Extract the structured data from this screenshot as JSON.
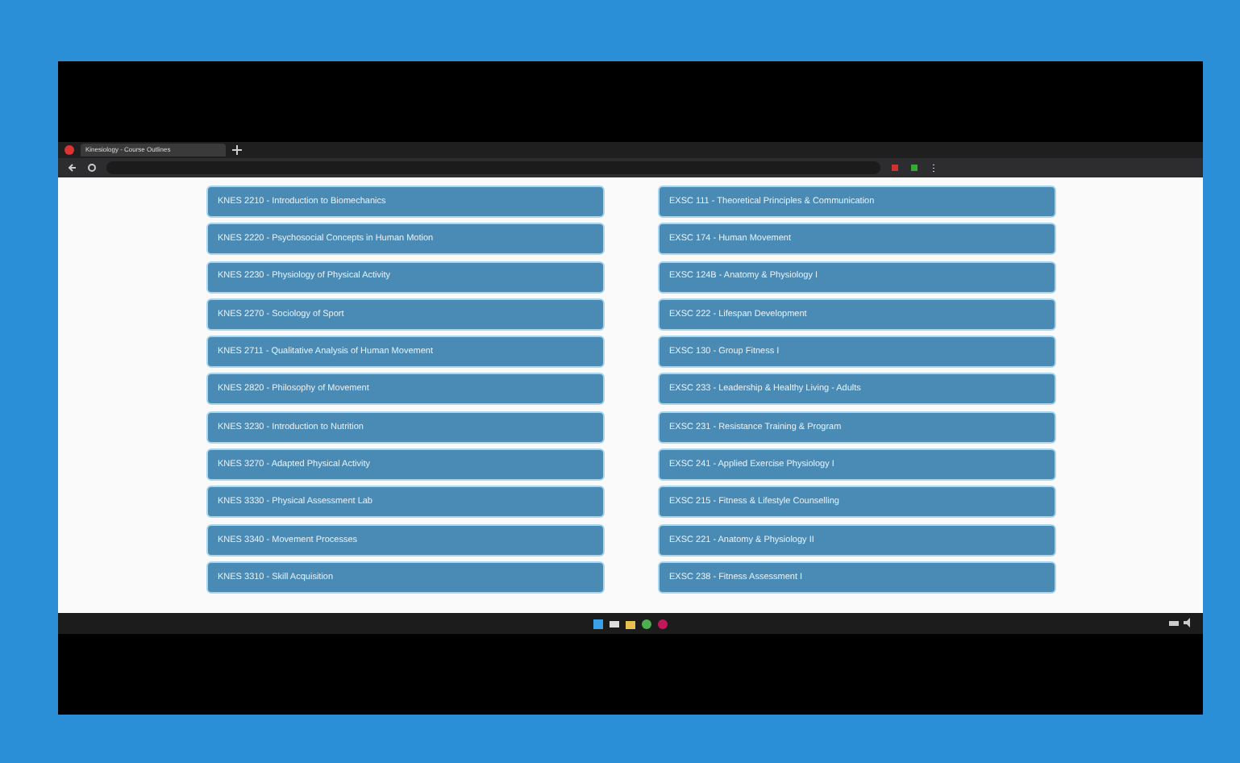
{
  "browser": {
    "tab_title": "Kinesiology - Course Outlines"
  },
  "courses_left": [
    {
      "label": "KNES 2210 - Introduction to Biomechanics"
    },
    {
      "label": "KNES 2220 - Psychosocial Concepts in Human Motion"
    },
    {
      "label": "KNES 2230 - Physiology of Physical Activity"
    },
    {
      "label": "KNES 2270 - Sociology of Sport"
    },
    {
      "label": "KNES 2711 - Qualitative Analysis of Human Movement"
    },
    {
      "label": "KNES 2820 - Philosophy of Movement"
    },
    {
      "label": "KNES 3230 - Introduction to Nutrition"
    },
    {
      "label": "KNES 3270 - Adapted Physical Activity"
    },
    {
      "label": "KNES 3330 - Physical Assessment Lab"
    },
    {
      "label": "KNES 3340 - Movement Processes"
    },
    {
      "label": "KNES 3310 - Skill Acquisition"
    }
  ],
  "courses_right": [
    {
      "label": "EXSC 111 - Theoretical Principles & Communication"
    },
    {
      "label": "EXSC 174 - Human Movement"
    },
    {
      "label": "EXSC 124B - Anatomy & Physiology I"
    },
    {
      "label": "EXSC 222 - Lifespan Development"
    },
    {
      "label": "EXSC 130 - Group Fitness I"
    },
    {
      "label": "EXSC 233 - Leadership & Healthy Living - Adults"
    },
    {
      "label": "EXSC 231 - Resistance Training & Program"
    },
    {
      "label": "EXSC 241 - Applied Exercise Physiology I"
    },
    {
      "label": "EXSC 215 - Fitness & Lifestyle Counselling"
    },
    {
      "label": "EXSC 221 - Anatomy & Physiology II"
    },
    {
      "label": "EXSC 238 - Fitness Assessment I"
    }
  ]
}
